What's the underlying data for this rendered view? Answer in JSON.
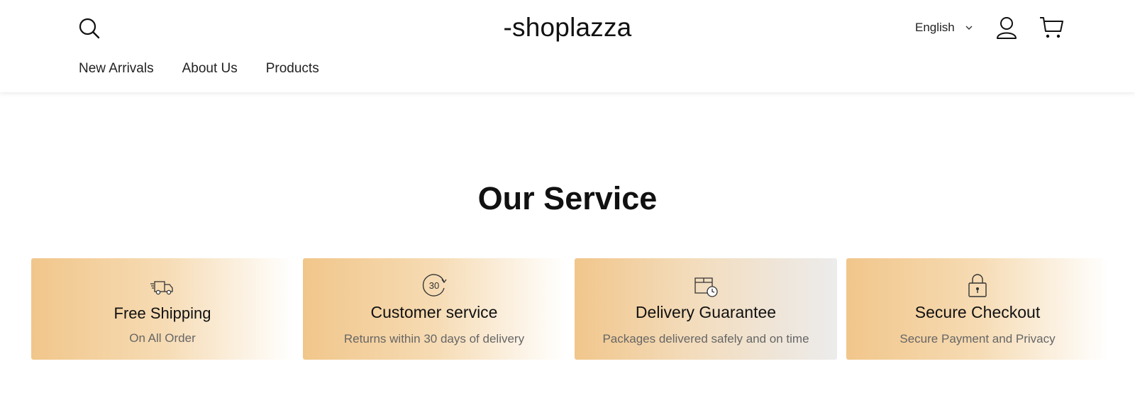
{
  "header": {
    "logo": "-shoplazza",
    "language": "English",
    "nav": [
      "New Arrivals",
      "About Us",
      "Products"
    ]
  },
  "services": {
    "title": "Our Service",
    "items": [
      {
        "icon": "truck-icon",
        "title": "Free Shipping",
        "subtitle": "On All Order"
      },
      {
        "icon": "30-days-icon",
        "title": "Customer service",
        "subtitle": "Returns within 30 days of delivery",
        "badge": "30"
      },
      {
        "icon": "package-clock-icon",
        "title": "Delivery Guarantee",
        "subtitle": "Packages delivered safely and on time"
      },
      {
        "icon": "lock-icon",
        "title": "Secure Checkout",
        "subtitle": "Secure Payment and Privacy"
      }
    ]
  }
}
